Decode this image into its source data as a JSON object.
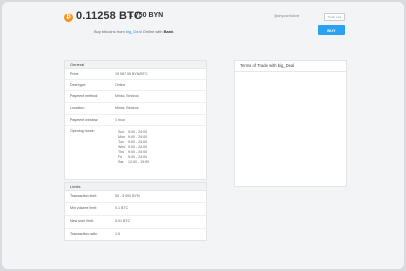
{
  "header": {
    "amount": "0.11258 BTC",
    "fiat": "1 750 BYN",
    "subline_prefix": "Buy bitcoins from",
    "trader": "big_Deal",
    "subline_mid": "Online with",
    "bank": "Bank",
    "user_mini_text": "@anyuserName",
    "user_mini_button": "Trade Link",
    "buy_label": "BUY"
  },
  "general": {
    "title": "General",
    "rows": [
      {
        "label": "Price:",
        "value": "15 587.55 BYN/BTC"
      },
      {
        "label": "Deal type:",
        "value": "Online"
      },
      {
        "label": "Payment method:",
        "value": "Minsk, Belarus"
      },
      {
        "label": "Location:",
        "value": "Minsk, Belarus"
      },
      {
        "label": "Payment window:",
        "value": "1 hour"
      }
    ],
    "opening_label": "Opening hours:",
    "hours": [
      {
        "day": "Sun",
        "time": "9:00 - 24:00"
      },
      {
        "day": "Mon",
        "time": "9:00 - 24:00"
      },
      {
        "day": "Tue",
        "time": "9:00 - 24:00"
      },
      {
        "day": "Wed",
        "time": "9:00 - 24:00"
      },
      {
        "day": "Thu",
        "time": "9:00 - 24:00"
      },
      {
        "day": "Fri",
        "time": "9:00 - 24:00"
      },
      {
        "day": "Sat",
        "time": "12:00 - 19:00"
      }
    ]
  },
  "limits": {
    "title": "Limits",
    "rows": [
      {
        "label": "Transaction limit:",
        "value": "50 - 5 000 BYN"
      },
      {
        "label": "Min volume limit:",
        "value": "0.1 BTC"
      },
      {
        "label": "New user limit:",
        "value": "0.01 BTC"
      },
      {
        "label": "Transaction ratio:",
        "value": "1:5"
      }
    ]
  },
  "terms": {
    "title": "Terms of Trade with big_Deal"
  },
  "colors": {
    "accent": "#2aa2f0",
    "btc": "#f7931a",
    "link": "#2c8be6"
  }
}
